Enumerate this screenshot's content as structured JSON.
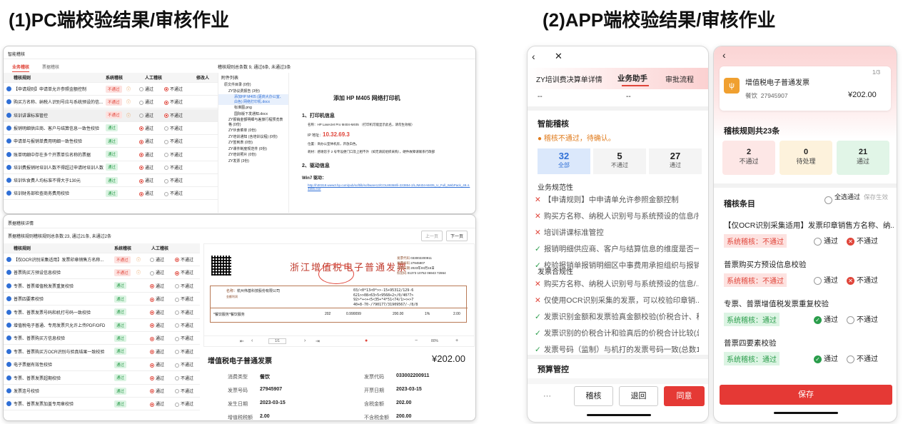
{
  "titles": {
    "pc": "(1)PC端校验结果/审核作业",
    "app": "(2)APP端校验结果/审核作业"
  },
  "pc1": {
    "header": "智能稽核",
    "tabs": [
      "业务稽核",
      "票据稽核"
    ],
    "summary": "稽核规则总条数 9, 通过6条, 未通过3条",
    "cols": [
      "稽核规则",
      "系统稽核",
      "人工稽核",
      "修改人"
    ],
    "rows": [
      {
        "t": "【申请规则】申请单允许参照金额控制",
        "s": "不通过",
        "f": true
      },
      {
        "t": "购买方名称、纳税人识别号应与系统预设的信...",
        "s": "不通过",
        "f": true
      },
      {
        "t": "培训讲课标准管控",
        "s": "不通过",
        "f": true
      },
      {
        "t": "报销明细供应商、客户与结算信息一致性校验",
        "s": "通过",
        "f": false
      },
      {
        "t": "申请单与报销单费用明细一致性校验",
        "s": "通过",
        "f": false
      },
      {
        "t": "账单明细中存在多个开票单位名称的票据",
        "s": "通过",
        "f": false
      },
      {
        "t": "培训费报销时培训人数不得超过申请时培训人数",
        "s": "通过",
        "f": false
      },
      {
        "t": "培训伙食费人均标准不得大于130元",
        "s": "通过",
        "f": false
      },
      {
        "t": "培训财务部检查商务费用校验",
        "s": "通过",
        "f": false
      }
    ],
    "opt_pass": "通过",
    "opt_fail": "不通过",
    "attach_title": "附件列表",
    "tree": [
      "原文件目录 (0份)",
      "ZY协议费报告 (3份)",
      "添加HP M405 (驱商大办公室、白色) 网络打印机.docx",
      "标准图.png",
      "国际版下发通知.docx",
      "ZY报销金额明细与差旅行程预览表格 (0份)",
      "ZY伙食菜单 (0份)",
      "ZY培训通知 (含培训议程) (0份)",
      "ZY签到表 (0份)",
      "ZY课件制度规范件 (0份)",
      "ZY培训照片 (0份)",
      "ZY发票 (3份)"
    ],
    "doc_title": "添加 HP M405 网络打印机",
    "doc_h1": "1、打印机信息",
    "doc_l1": "名称：HP LaserJet Pro M404-M405 （打印机可能显示此名，请勿生效规）",
    "doc_ip_label": "IP 地址：",
    "doc_ip": "10.32.69.3",
    "doc_l3": "位置：商办公室休机房，开放白色。",
    "doc_l4": "耗材：感谢您于 2 号专设便门口及上相不外（如无请前组织采购），硬件故障请联系行政部",
    "doc_h2": "2、驱动信息",
    "doc_win": "Win7 驱动：",
    "doc_link": "http://h30318.www3.hp.com/pub/softlib/software13/COL89368/li-223854-2/LJM404-M405_U_Full_WebPack_49.4.4565.exe"
  },
  "pc2": {
    "header": "票据稽核详情",
    "summary": "票据稽核规则稽核规则总条数:23, 通过21条, 未通过2条",
    "prev": "上一页",
    "next": "下一页",
    "cols": [
      "稽核规则",
      "系统稽核",
      "人工稽核"
    ],
    "rows": [
      {
        "t": "【仅OCR识别采集适用】发票印章销售方名称...",
        "s": "不通过",
        "f": true
      },
      {
        "t": "普票购买方预设信息校验",
        "s": "不通过",
        "f": true
      },
      {
        "t": "专票、普票增值税发票重复校验",
        "s": "通过",
        "f": false
      },
      {
        "t": "普票四要素校验",
        "s": "通过",
        "f": false
      },
      {
        "t": "专票、普票发票号码和机打号码一致校验",
        "s": "通过",
        "f": false
      },
      {
        "t": "增值税电子普通、专用发票只允许上传PDF/OFD",
        "s": "通过",
        "f": false
      },
      {
        "t": "专票、普票购买方信息校验",
        "s": "通过",
        "f": false
      },
      {
        "t": "专票、普票购买方OCR识别与验真结果一致校验",
        "s": "通过",
        "f": false
      },
      {
        "t": "电子票据有效性校验",
        "s": "通过",
        "f": false
      },
      {
        "t": "专票、普票发票超期校验",
        "s": "通过",
        "f": false
      },
      {
        "t": "发票连号校验",
        "s": "通过",
        "f": false
      },
      {
        "t": "专票、普票发票加盖专用章校验",
        "s": "通过",
        "f": false
      }
    ],
    "opt_pass": "通过",
    "opt_fail": "不通过",
    "invoice_title": "浙江增值税电子普通发票",
    "inv_code_label": "发票代码",
    "inv_code": "033002200911",
    "inv_no_label": "发票号码",
    "inv_no": "27945907",
    "inv_date_label": "开票日期",
    "inv_date": "2023年03月15日",
    "inv_check_label": "校验码",
    "inv_check": "01373 10752 06943 72864",
    "buyer_name": "名称：",
    "buyer_val": "杭州伟基科技股份有限公司",
    "seller_val": "金额利润",
    "cipher": [
      "03/<0*13<0*>>-15+95312/129-6",
      "621>>08<63>5<9568+2>/0/40?7>",
      "92>*+<+<5<35+*4*51<74/1><+>7",
      "40+8-70-/?90177/31909567/-/8/8"
    ],
    "item_name": "*餐饮服务*餐饮服务",
    "item_amt": "202",
    "item_price": "0.990099",
    "item_total": "200.00",
    "item_rate": "1%",
    "item_tax": "2.00",
    "pages": "1/1",
    "zoom": "80%",
    "card_title": "增值税电子普通发票",
    "card_amount": "¥202.00",
    "fields": [
      [
        "消费类型",
        "餐饮"
      ],
      [
        "发票代码",
        "033002200911"
      ],
      [
        "发票号码",
        "27945907"
      ],
      [
        "开票日期",
        "2023-03-15"
      ],
      [
        "发生日期",
        "2023-03-15"
      ],
      [
        "含税金额",
        "202.00"
      ],
      [
        "增值税税额",
        "2.00"
      ],
      [
        "不含税金额",
        "200.00"
      ]
    ]
  },
  "app1": {
    "tabs": [
      "ZY培训费决算单详情",
      "业务助手",
      "审批流程"
    ],
    "dash": [
      "--",
      "--"
    ],
    "section": "智能稽核",
    "warn": "稽核不通过，待确认。",
    "stats": [
      {
        "n": "32",
        "l": "全部"
      },
      {
        "n": "5",
        "l": "不通过"
      },
      {
        "n": "27",
        "l": "通过"
      }
    ],
    "g1": "业务规范性",
    "lines1": [
      {
        "t": "【申请规则】中申请单允许参照金额控制",
        "f": true
      },
      {
        "t": "购买方名称、纳税人识别号与系统预设的信息/抬头规...",
        "f": true
      },
      {
        "t": "培训讲课标准管控",
        "f": true
      },
      {
        "t": "报销明细供应商、客户与结算信息的维度是否一致。",
        "f": false
      },
      {
        "t": "校验报销单报销明细区中事费用承担组织与报销单费...",
        "f": false
      }
    ],
    "g2": "发票合规性",
    "lines2": [
      {
        "t": "购买方名称、纳税人识别号与系统预设的信息/...(总数1)",
        "f": true
      },
      {
        "t": "仅使用OCR识别采集的发票，可以校验印章销...(总数1)",
        "f": true
      },
      {
        "t": "发票识别金额和发票验真金额校验(价税合计、税...(总数1)",
        "f": false
      },
      {
        "t": "发票识别的价税合计和验真后的价税合计比较(总数1)",
        "f": false
      },
      {
        "t": "发票号码（监制）与机打的发票号码一致(总数1)",
        "f": false
      }
    ],
    "section2": "预算管控",
    "more": "···",
    "btn1": "稽核",
    "btn2": "退回",
    "btn3": "同意"
  },
  "app2": {
    "card_title": "增值税电子普通发票",
    "card_sub": "餐饮",
    "card_no": "27945907",
    "card_amt": "¥202.00",
    "page": "1/3",
    "rules_total": "稽核规则共23条",
    "stats": [
      {
        "n": "2",
        "l": "不通过"
      },
      {
        "n": "0",
        "l": "待处理"
      },
      {
        "n": "21",
        "l": "通过"
      }
    ],
    "items_title": "稽核条目",
    "select_all": "全选通过",
    "save_effect": "保存生效",
    "items": [
      {
        "t": "【仅OCR识别采集适用】发票印章销售方名称、纳...",
        "s": "系统稽核：不通过",
        "f": true
      },
      {
        "t": "普票购买方预设信息校验",
        "s": "系统稽核：不通过",
        "f": true
      },
      {
        "t": "专票、普票增值税发票重复校验",
        "s": "系统稽核：通过",
        "f": false
      },
      {
        "t": "普票四要素校验",
        "s": "系统稽核：通过",
        "f": false
      }
    ],
    "opt_pass": "通过",
    "opt_fail": "不通过",
    "save": "保存"
  }
}
